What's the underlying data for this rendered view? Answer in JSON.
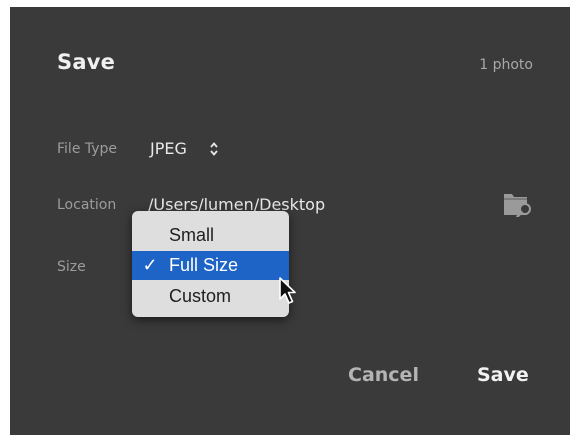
{
  "dialog": {
    "title": "Save",
    "photo_count": "1 photo"
  },
  "file_type": {
    "label": "File Type",
    "value": "JPEG",
    "icon": "up-down-chevron-icon"
  },
  "location": {
    "label": "Location",
    "value": "/Users/lumen/Desktop",
    "icon": "folder-search-icon"
  },
  "size": {
    "label": "Size",
    "options": [
      {
        "label": "Small",
        "checked": ""
      },
      {
        "label": "Full Size",
        "checked": "✓"
      },
      {
        "label": "Custom",
        "checked": ""
      }
    ],
    "selected": "Full Size"
  },
  "buttons": {
    "cancel": "Cancel",
    "save": "Save"
  },
  "colors": {
    "dialog_bg": "#3a3a3a",
    "menu_bg": "#dedede",
    "menu_highlight": "#1d64c6"
  }
}
